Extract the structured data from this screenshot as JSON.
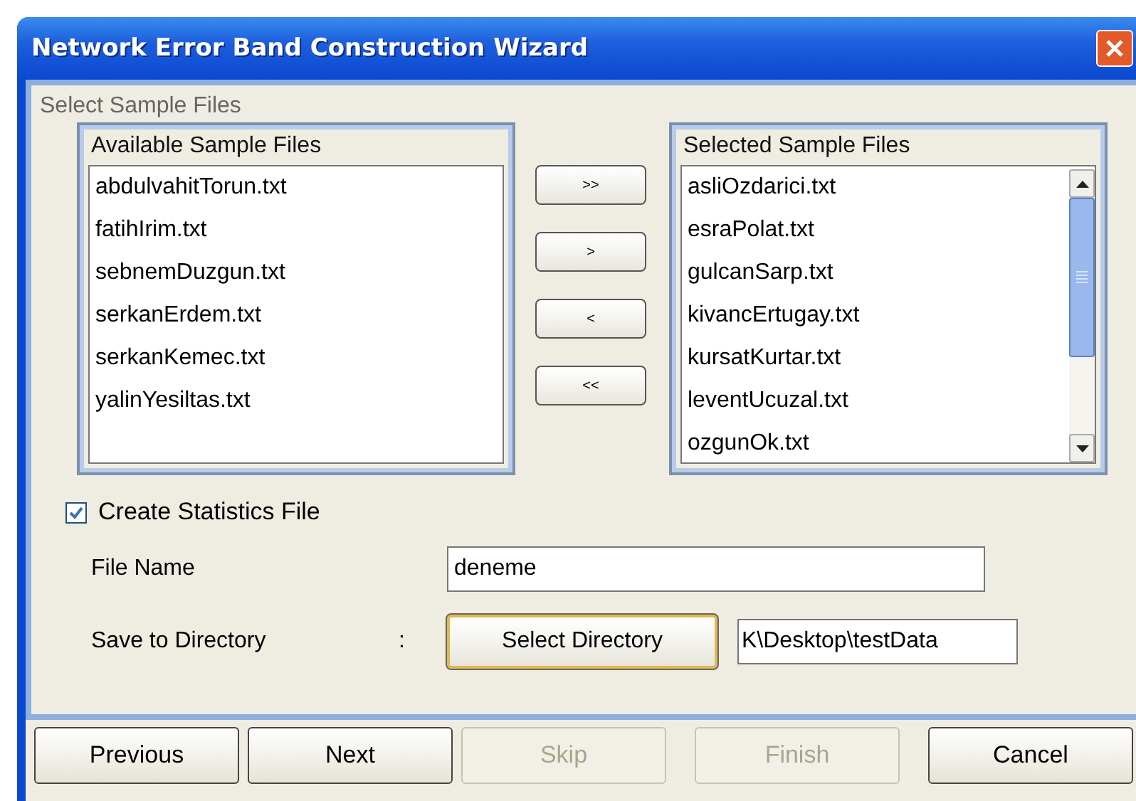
{
  "window": {
    "title": "Network Error Band Construction Wizard"
  },
  "section_title": "Select Sample Files",
  "available": {
    "title": "Available Sample Files",
    "items": [
      "abdulvahitTorun.txt",
      "fatihIrim.txt",
      "sebnemDuzgun.txt",
      "serkanErdem.txt",
      "serkanKemec.txt",
      "yalinYesiltas.txt"
    ]
  },
  "move_buttons": [
    ">>",
    ">",
    "<",
    "<<"
  ],
  "selected_files": {
    "title": "Selected Sample Files",
    "items": [
      "asliOzdarici.txt",
      "esraPolat.txt",
      "gulcanSarp.txt",
      "kivancErtugay.txt",
      "kursatKurtar.txt",
      "leventUcuzal.txt",
      "ozgunOk.txt"
    ]
  },
  "statistics": {
    "label": "Create Statistics File",
    "checked": true
  },
  "file_name": {
    "label": "File Name",
    "value": "deneme"
  },
  "directory": {
    "label": "Save to Directory",
    "separator": ":",
    "button": "Select Directory",
    "value": "K\\Desktop\\testData"
  },
  "buttons": [
    {
      "label": "Previous",
      "disabled": false
    },
    {
      "label": "Next",
      "disabled": false
    },
    {
      "label": "Skip",
      "disabled": true
    },
    {
      "label": "Finish",
      "disabled": true
    },
    {
      "label": "Cancel",
      "disabled": false
    }
  ]
}
